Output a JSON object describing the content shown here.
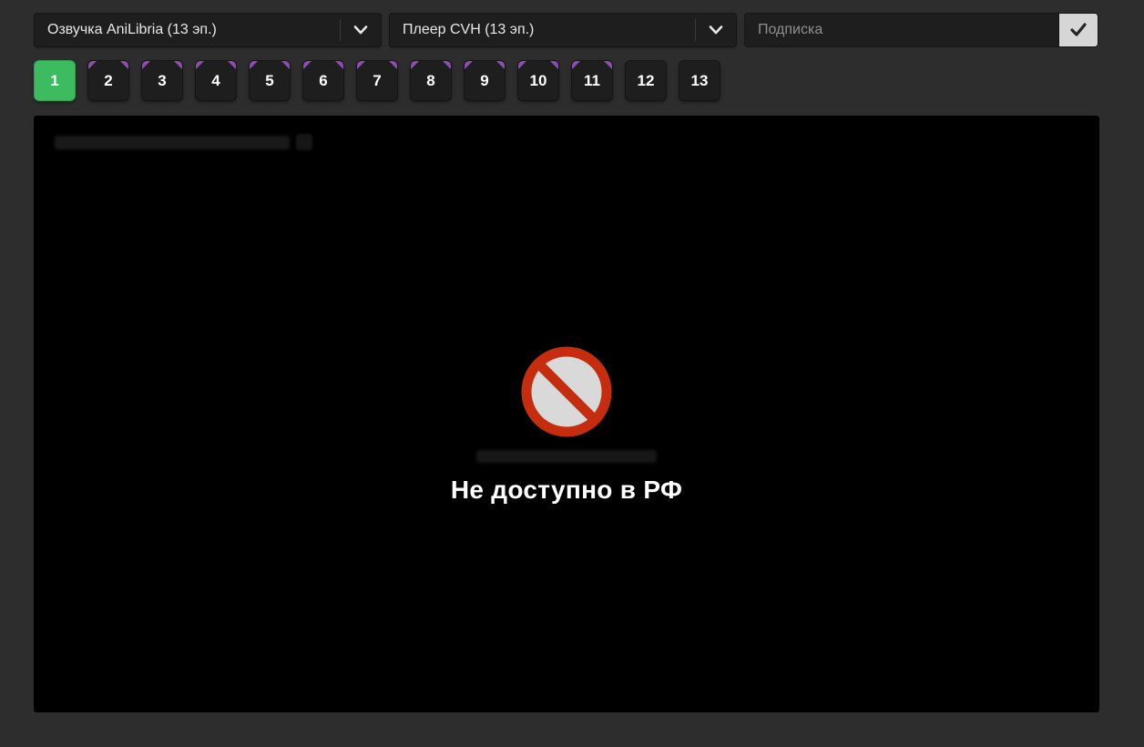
{
  "controls": {
    "voice_select": {
      "value": "Озвучка AniLibria (13 эп.)"
    },
    "player_select": {
      "value": "Плеер CVH (13 эп.)"
    },
    "subscription": {
      "placeholder": "Подписка"
    }
  },
  "episodes": {
    "items": [
      {
        "label": "1",
        "active": true,
        "watched": false
      },
      {
        "label": "2",
        "active": false,
        "watched": true
      },
      {
        "label": "3",
        "active": false,
        "watched": true
      },
      {
        "label": "4",
        "active": false,
        "watched": true
      },
      {
        "label": "5",
        "active": false,
        "watched": true
      },
      {
        "label": "6",
        "active": false,
        "watched": true
      },
      {
        "label": "7",
        "active": false,
        "watched": true
      },
      {
        "label": "8",
        "active": false,
        "watched": true
      },
      {
        "label": "9",
        "active": false,
        "watched": true
      },
      {
        "label": "10",
        "active": false,
        "watched": true
      },
      {
        "label": "11",
        "active": false,
        "watched": true
      },
      {
        "label": "12",
        "active": false,
        "watched": false
      },
      {
        "label": "13",
        "active": false,
        "watched": false
      }
    ]
  },
  "player": {
    "message": "Не доступно в РФ"
  },
  "colors": {
    "active_green": "#3cbb60",
    "watched_purple": "#8a4fb0",
    "ban_red": "#c62d0e",
    "ban_fill": "#d9d9d9"
  }
}
